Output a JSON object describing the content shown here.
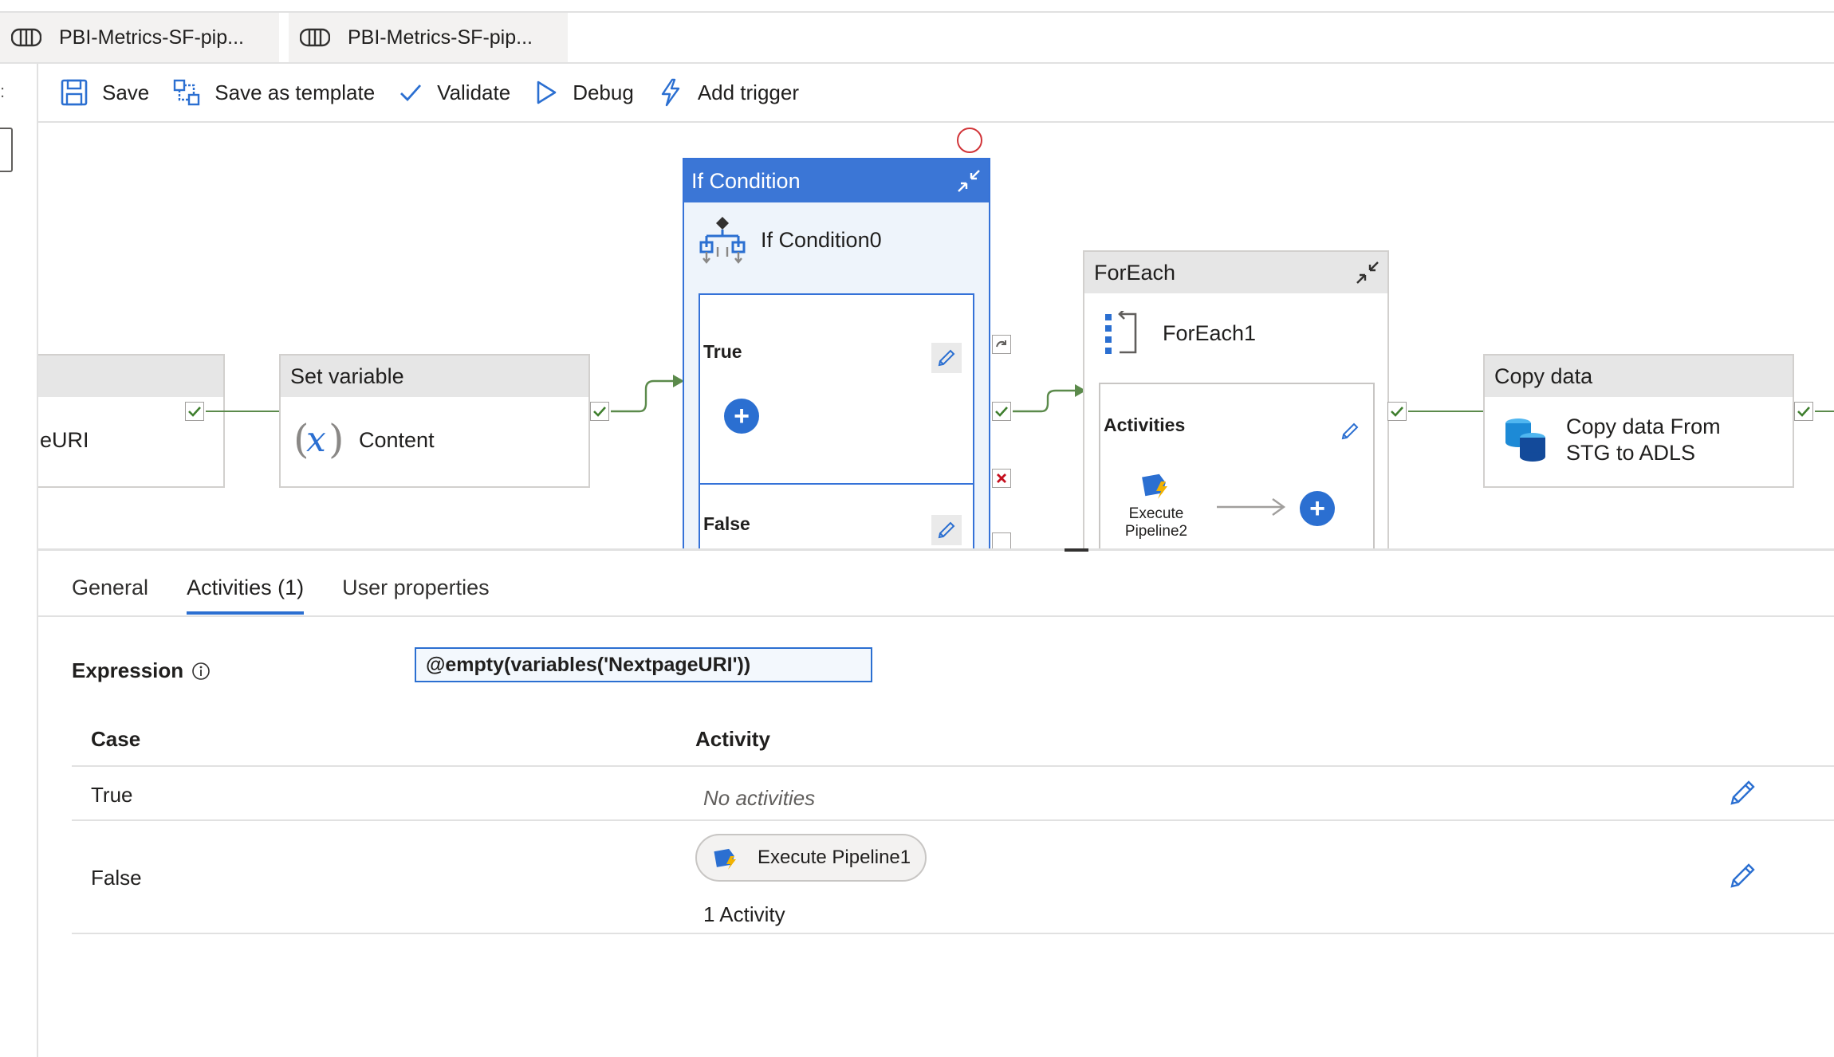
{
  "tabs": [
    {
      "label": "PBI-Metrics-SF-pip...",
      "icon": "pipeline-icon"
    },
    {
      "label": "PBI-Metrics-SF-pip...",
      "icon": "pipeline-icon"
    }
  ],
  "toolbar": {
    "save": "Save",
    "save_template": "Save as template",
    "validate": "Validate",
    "debug": "Debug",
    "add_trigger": "Add trigger"
  },
  "canvas": {
    "partial_activity_text": "eURI",
    "set_variable": {
      "header": "Set variable",
      "name": "Content",
      "icon": "variable-icon"
    },
    "if_condition": {
      "header": "If Condition",
      "name": "If Condition0",
      "true_label": "True",
      "false_label": "False"
    },
    "foreach": {
      "header": "ForEach",
      "name": "ForEach1",
      "activities_label": "Activities",
      "inner_activity_line1": "Execute",
      "inner_activity_line2": "Pipeline2"
    },
    "copy_data": {
      "header": "Copy data",
      "name_line1": "Copy data From",
      "name_line2": "STG to ADLS"
    }
  },
  "properties": {
    "tabs": [
      "General",
      "Activities (1)",
      "User properties"
    ],
    "active_tab": "Activities (1)",
    "expression_label": "Expression",
    "expression_value": "@empty(variables('NextpageURI'))",
    "columns": {
      "case": "Case",
      "activity": "Activity"
    },
    "rows": [
      {
        "case": "True",
        "activity_text": "No activities"
      },
      {
        "case": "False",
        "activity_pill": "Execute Pipeline1",
        "activity_count": "1 Activity"
      }
    ]
  },
  "colors": {
    "accent": "#2b6fd1",
    "if_header": "#3b76d6",
    "success_connector": "#5b8a4b",
    "failure": "#c50f1f"
  }
}
